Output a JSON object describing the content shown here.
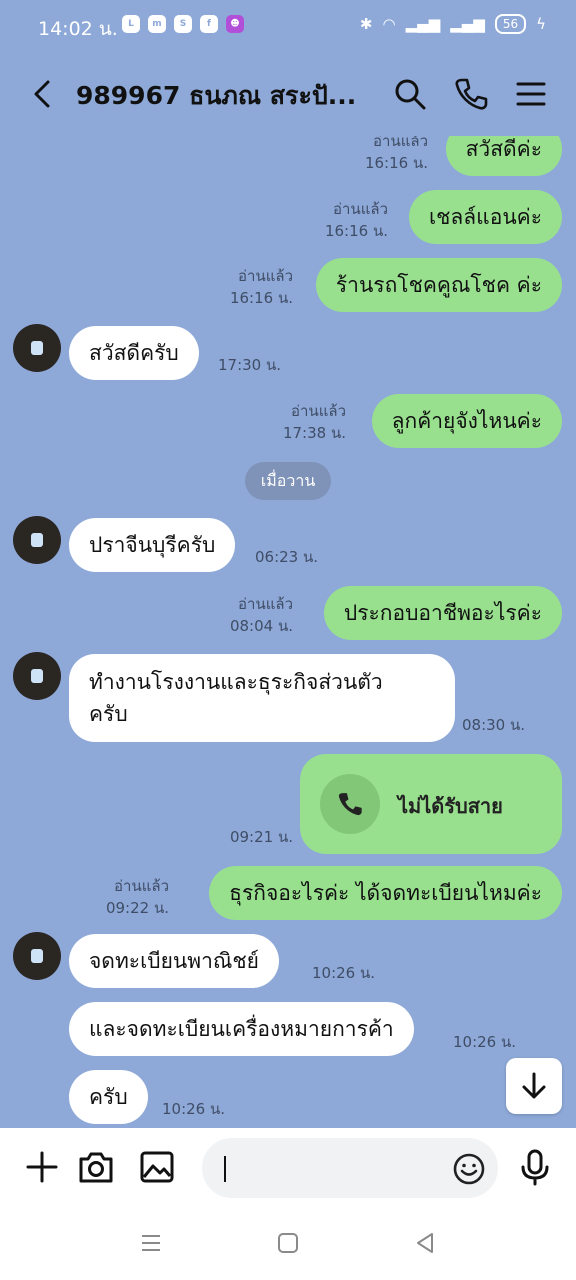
{
  "status_bar": {
    "time": "14:02 น.",
    "app_icons": [
      "LINE",
      "messenger",
      "shopee",
      "facebook",
      "game"
    ],
    "battery": "56"
  },
  "header": {
    "title": "989967 ธนภณ สระปั..."
  },
  "messages": {
    "m1": {
      "text": "สวัสดีค่ะ",
      "read": "อ่านแล้ว",
      "time": "16:16 น."
    },
    "m2": {
      "text": "เชลล์แอนค่ะ",
      "read": "อ่านแล้ว",
      "time": "16:16 น."
    },
    "m3": {
      "text": "ร้านรถโชคคูณโชค ค่ะ",
      "read": "อ่านแล้ว",
      "time": "16:16 น."
    },
    "m4": {
      "text": "สวัสดีครับ",
      "time": "17:30 น."
    },
    "m5": {
      "text": "ลูกค้ายุจังไหนค่ะ",
      "read": "อ่านแล้ว",
      "time": "17:38 น."
    },
    "date_chip": "เมื่อวาน",
    "m6": {
      "text": "ปราจีนบุรีครับ",
      "time": "06:23 น."
    },
    "m7": {
      "text": "ประกอบอาชีพอะไรค่ะ",
      "read": "อ่านแล้ว",
      "time": "08:04 น."
    },
    "m8": {
      "line1": "ทำงานโรงงานและธุระกิจส่วนตัว",
      "line2": "ครับ",
      "time": "08:30 น."
    },
    "call": {
      "text": "ไม่ได้รับสาย",
      "time": "09:21 น."
    },
    "m9": {
      "text": "ธุรกิจอะไรค่ะ ได้จดทะเบียนไหมค่ะ",
      "read": "อ่านแล้ว",
      "time": "09:22 น."
    },
    "m10": {
      "text": "จดทะเบียนพาณิชย์",
      "time": "10:26 น."
    },
    "m11": {
      "text": "และจดทะเบียนเครื่องหมายการค้า",
      "time": "10:26 น."
    },
    "m12": {
      "text": "ครับ",
      "time": "10:26 น."
    }
  },
  "colors": {
    "background": "#8ea9d8",
    "outgoing_bubble": "#98e08e",
    "incoming_bubble": "#ffffff"
  }
}
